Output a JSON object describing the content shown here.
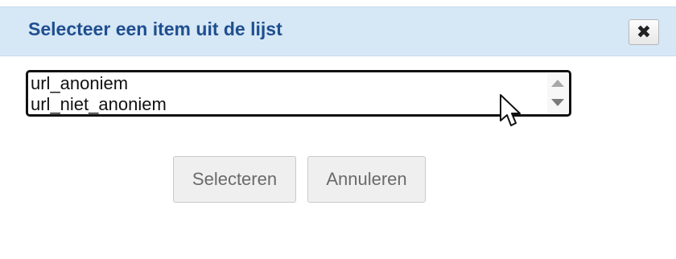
{
  "dialog": {
    "title": "Selecteer een item uit de lijst",
    "close_icon": "close-icon",
    "close_label": "✖"
  },
  "list": {
    "items": [
      {
        "label": "url_anoniem"
      },
      {
        "label": "url_niet_anoniem"
      }
    ]
  },
  "buttons": {
    "select_label": "Selecteren",
    "cancel_label": "Annuleren"
  },
  "colors": {
    "titlebar_bg": "#d6e7f6",
    "title_text": "#1f4f8f"
  }
}
